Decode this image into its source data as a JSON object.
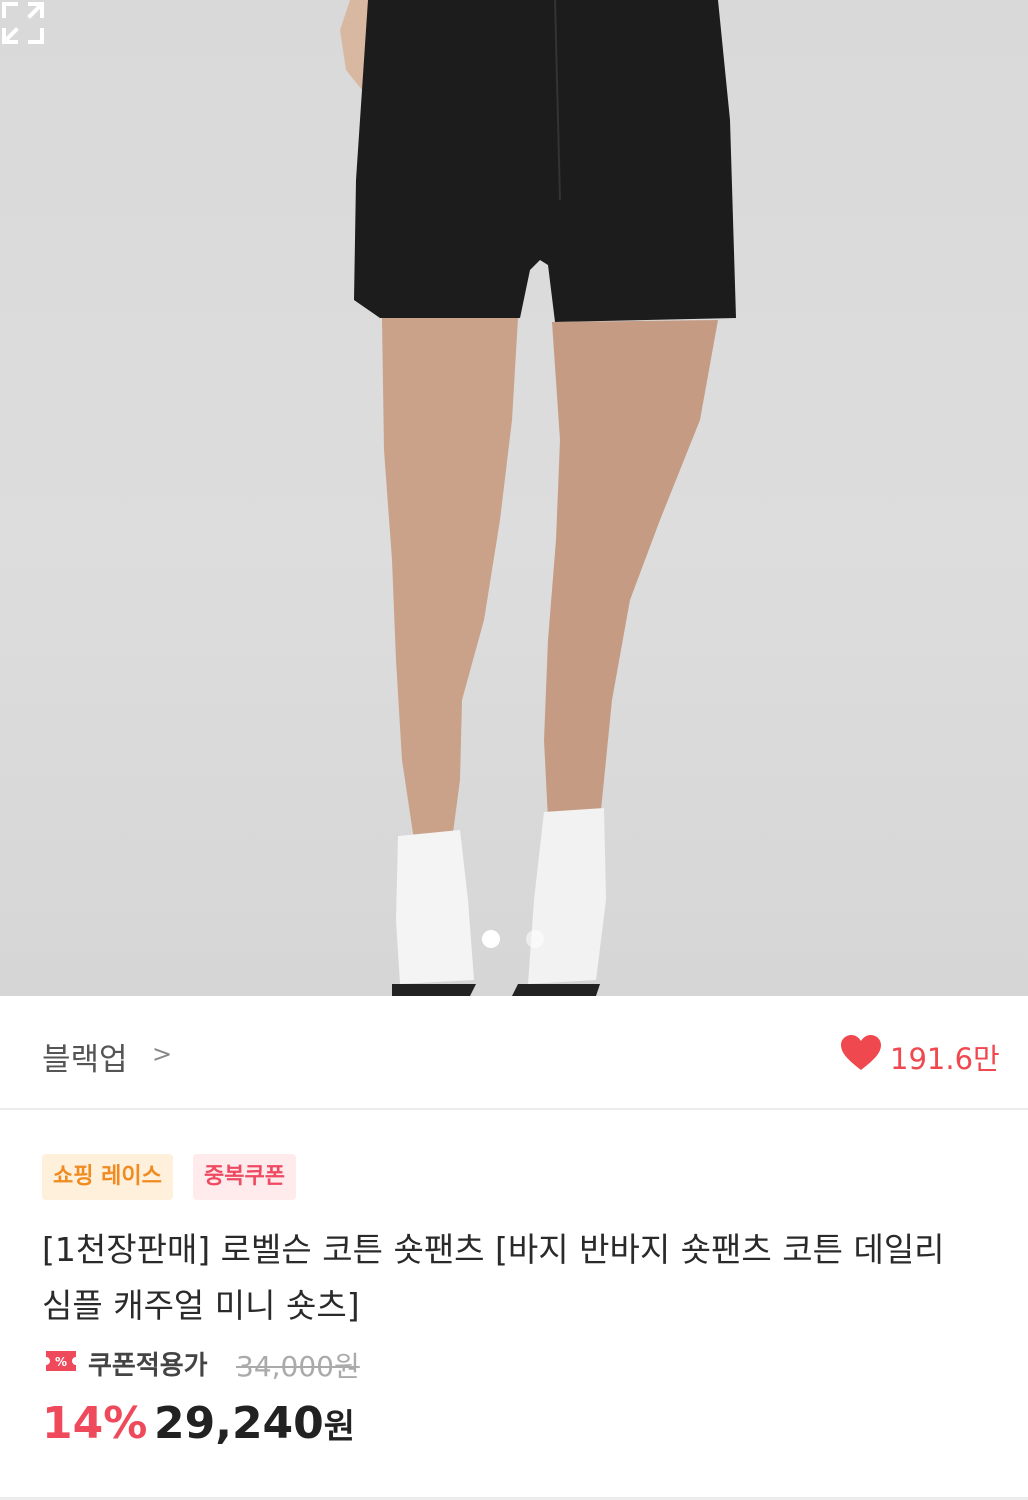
{
  "product_image": {
    "icon": "product-photo",
    "current_page": 1,
    "page_count": 2
  },
  "store": {
    "name": "블랙업",
    "chevron": ">"
  },
  "likes": {
    "count": "191.6만",
    "icon": "heart-icon",
    "color": "#f0484f"
  },
  "badges": [
    {
      "label": "쇼핑 레이스",
      "color": "#f08b21",
      "bg": "#fff0dc"
    },
    {
      "label": "중복쿠폰",
      "color": "#ee4a61",
      "bg": "#ffeaec"
    }
  ],
  "title": "[1천장판매] 로벨슨 코튼 숏팬츠 [바지 반바지 숏팬츠 코튼 데일리 심플 캐주얼 미니 숏츠]",
  "price": {
    "coupon_label": "쿠폰적용가",
    "original": "34,000원",
    "discount": "14%",
    "final": "29,240",
    "unit": "원"
  }
}
